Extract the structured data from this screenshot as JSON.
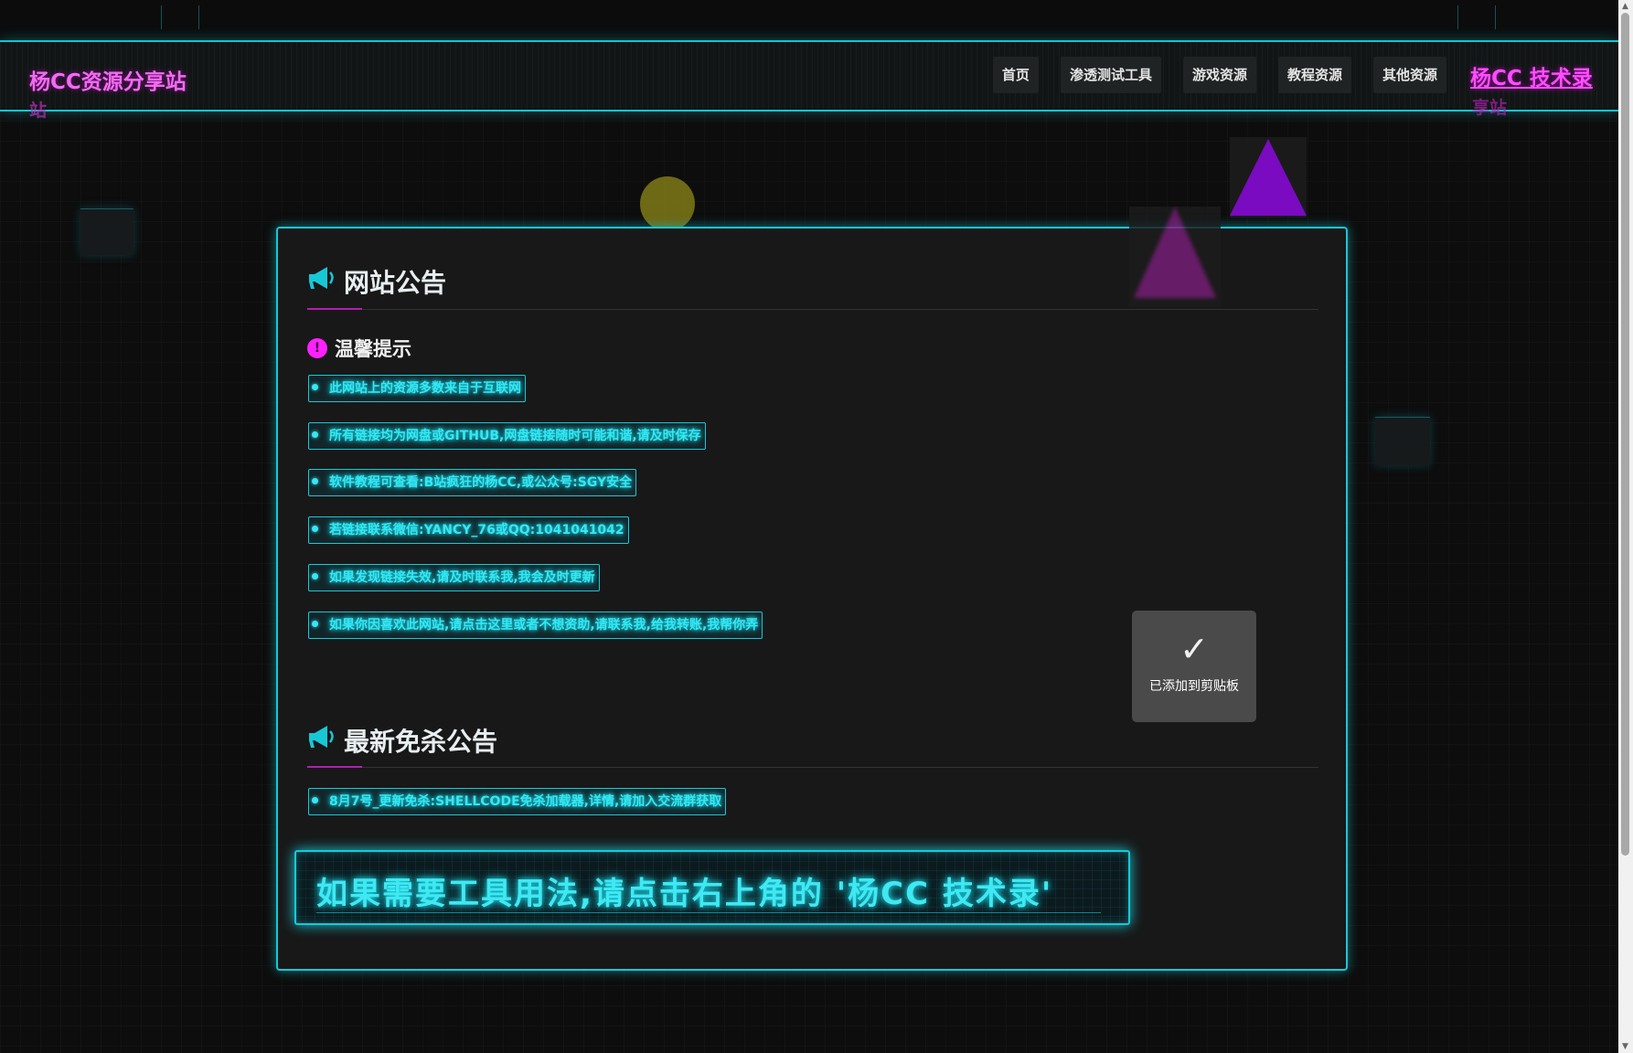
{
  "navbar": {
    "brand": "杨CC资源分享站",
    "brand_ghost": "站",
    "items": [
      {
        "label": "首页"
      },
      {
        "label": "渗透测试工具"
      },
      {
        "label": "游戏资源"
      },
      {
        "label": "教程资源"
      },
      {
        "label": "其他资源"
      }
    ],
    "tech_link": "杨CC 技术录",
    "tech_ghost": "享站"
  },
  "announcement": {
    "title": "网站公告",
    "tip_title": "温馨提示",
    "tip_icon": "!",
    "notices": [
      "此网站上的资源多数来自于互联网",
      "所有链接均为网盘或GITHUB,网盘链接随时可能和谐,请及时保存",
      "软件教程可查看:B站疯狂的杨CC,或公众号:SGY安全",
      "若链接联系微信:YANCY_76或QQ:1041041042",
      "如果发现链接失效,请及时联系我,我会及时更新",
      "如果你因喜欢此网站,请点击这里或者不想资助,请联系我,给我转账,我帮你弄"
    ]
  },
  "av": {
    "title": "最新免杀公告",
    "notices": [
      "8月7号_更新免杀:SHELLCODE免杀加载器,详情,请加入交流群获取"
    ]
  },
  "banner": {
    "text": "如果需要工具用法,请点击右上角的 '杨CC 技术录'"
  },
  "toast": {
    "check": "✓",
    "message": "已添加到剪贴板"
  },
  "colors": {
    "accent_cyan": "#17c7d6",
    "accent_magenta": "#ff20ff",
    "triangle_purple": "#7a0bc0"
  }
}
